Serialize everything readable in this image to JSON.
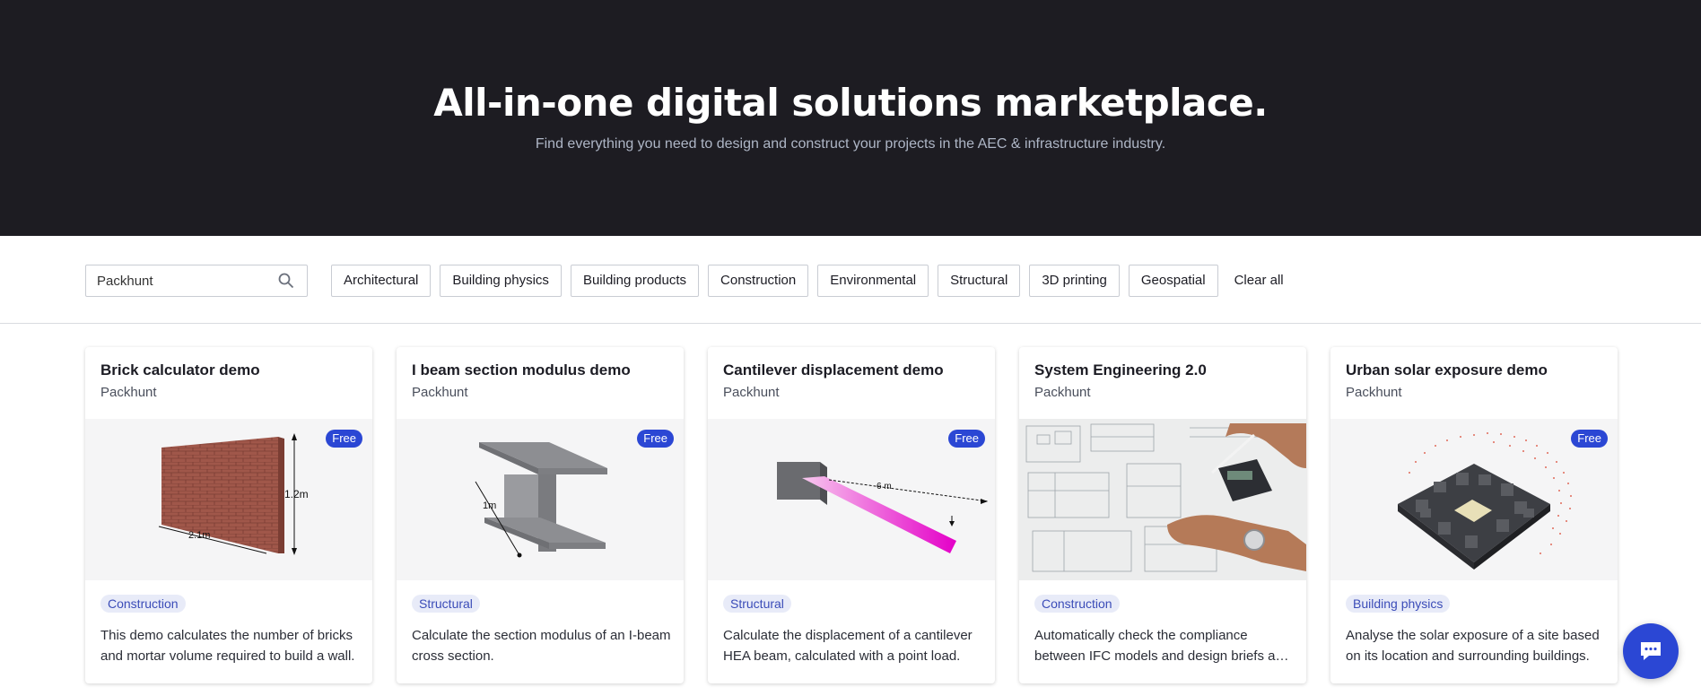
{
  "hero": {
    "title": "All-in-one digital solutions marketplace.",
    "subtitle": "Find everything you need to design and construct your projects in the AEC & infrastructure industry."
  },
  "search": {
    "value": "Packhunt",
    "icon": "search-icon"
  },
  "filters": [
    {
      "label": "Architectural"
    },
    {
      "label": "Building physics"
    },
    {
      "label": "Building products"
    },
    {
      "label": "Construction"
    },
    {
      "label": "Environmental"
    },
    {
      "label": "Structural"
    },
    {
      "label": "3D printing"
    },
    {
      "label": "Geospatial"
    }
  ],
  "clear_label": "Clear all",
  "cards": [
    {
      "title": "Brick calculator demo",
      "author": "Packhunt",
      "badge": "Free",
      "tag": "Construction",
      "description": "This demo calculates the number of bricks and mortar volume required to build a wall.",
      "img_labels": [
        "1.2m",
        "2.1m"
      ]
    },
    {
      "title": "I beam section modulus demo",
      "author": "Packhunt",
      "badge": "Free",
      "tag": "Structural",
      "description": "Calculate the section modulus of an I-beam cross section.",
      "img_labels": [
        "1m"
      ]
    },
    {
      "title": "Cantilever displacement demo",
      "author": "Packhunt",
      "badge": "Free",
      "tag": "Structural",
      "description": "Calculate the displacement of a cantilever HEA beam, calculated with a point load.",
      "img_labels": [
        "6 m"
      ]
    },
    {
      "title": "System Engineering 2.0",
      "author": "Packhunt",
      "badge": "",
      "tag": "Construction",
      "description": "Automatically check the compliance between IFC models and design briefs and requirements.",
      "img_labels": []
    },
    {
      "title": "Urban solar exposure demo",
      "author": "Packhunt",
      "badge": "Free",
      "tag": "Building physics",
      "description": "Analyse the solar exposure of a site based on its location and surrounding buildings.",
      "img_labels": []
    }
  ],
  "chat": {
    "icon": "chat-icon"
  },
  "colors": {
    "hero_bg": "#1d1c22",
    "accent": "#2b47d4",
    "tag_bg": "#e8ebf8"
  }
}
